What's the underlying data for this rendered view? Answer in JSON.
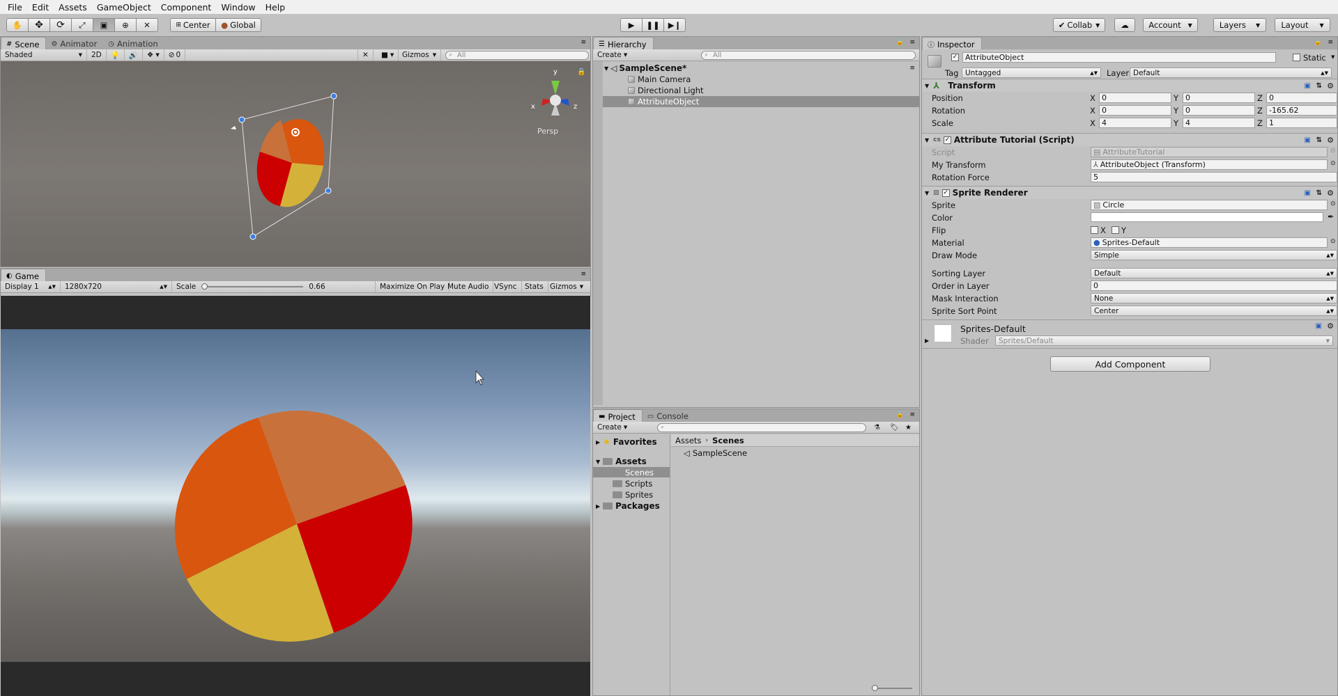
{
  "menu": [
    "File",
    "Edit",
    "Assets",
    "GameObject",
    "Component",
    "Window",
    "Help"
  ],
  "toolbar": {
    "pivot": "Center",
    "space": "Global",
    "collab": "Collab",
    "account": "Account",
    "layers": "Layers",
    "layout": "Layout"
  },
  "scene": {
    "tabs": [
      "Scene",
      "Animator",
      "Animation"
    ],
    "shading": "Shaded",
    "mode2d": "2D",
    "fx_count": "0",
    "gizmos": "Gizmos",
    "search_placeholder": "All",
    "persp_label": "Persp",
    "axis_y": "y",
    "axis_x": "x",
    "axis_z": "z"
  },
  "game": {
    "tab": "Game",
    "display": "Display 1",
    "resolution": "1280x720",
    "scale_label": "Scale",
    "scale_value": "0.66",
    "scale_fraction": 0.66,
    "buttons": [
      "Maximize On Play",
      "Mute Audio",
      "VSync",
      "Stats",
      "Gizmos"
    ]
  },
  "hierarchy": {
    "tab": "Hierarchy",
    "create": "Create",
    "search_placeholder": "All",
    "scene_name": "SampleScene*",
    "items": [
      "Main Camera",
      "Directional Light",
      "AttributeObject"
    ]
  },
  "project": {
    "tabs": [
      "Project",
      "Console"
    ],
    "create": "Create",
    "favorites": "Favorites",
    "assets": "Assets",
    "folders": [
      "Scenes",
      "Scripts",
      "Sprites"
    ],
    "packages": "Packages",
    "breadcrumb": [
      "Assets",
      "Scenes"
    ],
    "files": [
      "SampleScene"
    ]
  },
  "inspector": {
    "tab": "Inspector",
    "object_name": "AttributeObject",
    "static_label": "Static",
    "tag_label": "Tag",
    "tag_value": "Untagged",
    "layer_label": "Layer",
    "layer_value": "Default",
    "transform": {
      "title": "Transform",
      "rows": [
        {
          "label": "Position",
          "x": "0",
          "y": "0",
          "z": "0"
        },
        {
          "label": "Rotation",
          "x": "0",
          "y": "0",
          "z": "-165.62"
        },
        {
          "label": "Scale",
          "x": "4",
          "y": "4",
          "z": "1"
        }
      ]
    },
    "script": {
      "title": "Attribute Tutorial (Script)",
      "script_label": "Script",
      "script_value": "AttributeTutorial",
      "my_transform_label": "My Transform",
      "my_transform_value": "AttributeObject (Transform)",
      "rotation_force_label": "Rotation Force",
      "rotation_force_value": "5"
    },
    "sprite_renderer": {
      "title": "Sprite Renderer",
      "sprite_label": "Sprite",
      "sprite_value": "Circle",
      "color_label": "Color",
      "color_value": "#ffffff",
      "flip_label": "Flip",
      "flip_x": "X",
      "flip_y": "Y",
      "material_label": "Material",
      "material_value": "Sprites-Default",
      "draw_mode_label": "Draw Mode",
      "draw_mode_value": "Simple",
      "sorting_layer_label": "Sorting Layer",
      "sorting_layer_value": "Default",
      "order_label": "Order in Layer",
      "order_value": "0",
      "mask_label": "Mask Interaction",
      "mask_value": "None",
      "sort_point_label": "Sprite Sort Point",
      "sort_point_value": "Center"
    },
    "material": {
      "name": "Sprites-Default",
      "shader_label": "Shader",
      "shader_value": "Sprites/Default"
    },
    "add_component": "Add Component"
  },
  "colors": {
    "pie_orange": "#d9560f",
    "pie_light_orange": "#c8713a",
    "pie_red": "#cc0000",
    "pie_yellow": "#d4b23a"
  }
}
